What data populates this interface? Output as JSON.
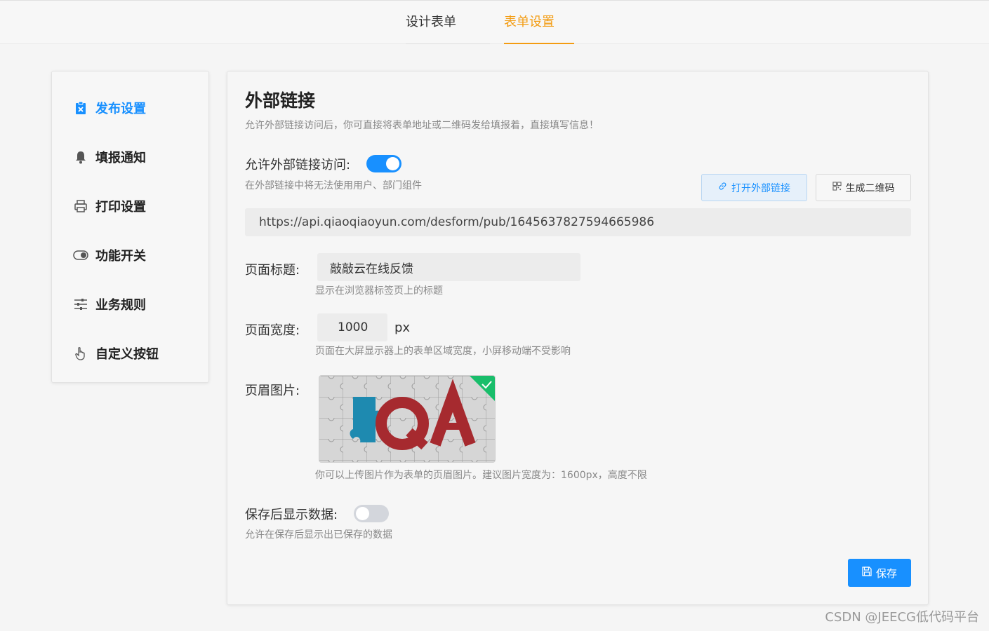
{
  "tabs": [
    {
      "label": "设计表单",
      "active": false
    },
    {
      "label": "表单设置",
      "active": true
    }
  ],
  "colors": {
    "accent": "#1890ff",
    "tab_active": "#f39c12"
  },
  "sidebar": {
    "items": [
      {
        "label": "发布设置",
        "icon": "clipboard-x-icon",
        "active": true
      },
      {
        "label": "填报通知",
        "icon": "bell-icon",
        "active": false
      },
      {
        "label": "打印设置",
        "icon": "printer-icon",
        "active": false
      },
      {
        "label": "功能开关",
        "icon": "toggle-icon",
        "active": false
      },
      {
        "label": "业务规则",
        "icon": "sliders-icon",
        "active": false
      },
      {
        "label": "自定义按钮",
        "icon": "pointer-hand-icon",
        "active": false
      }
    ]
  },
  "main": {
    "title": "外部链接",
    "description": "允许外部链接访问后，你可直接将表单地址或二维码发给填报着，直接填写信息！",
    "external_access": {
      "label": "允许外部链接访问:",
      "enabled": true,
      "hint": "在外部链接中将无法使用用户、部门组件"
    },
    "open_link_button": "打开外部链接",
    "qr_button": "生成二维码",
    "url": "https://api.qiaoqiaoyun.com/desform/pub/1645637827594665986",
    "page_title": {
      "label": "页面标题:",
      "value": "敲敲云在线反馈",
      "hint": "显示在浏览器标签页上的标题"
    },
    "page_width": {
      "label": "页面宽度:",
      "value": "1000",
      "unit": "px",
      "hint": "页面在大屏显示器上的表单区域宽度，小屏移动端不受影响"
    },
    "header_image": {
      "label": "页眉图片:",
      "image_text": "QA",
      "hint": "你可以上传图片作为表单的页眉图片。建议图片宽度为：1600px，高度不限"
    },
    "show_after_save": {
      "label": "保存后显示数据:",
      "enabled": false,
      "hint": "允许在保存后显示出已保存的数据"
    },
    "save_button": "保存"
  },
  "watermark": "CSDN @JEECG低代码平台"
}
